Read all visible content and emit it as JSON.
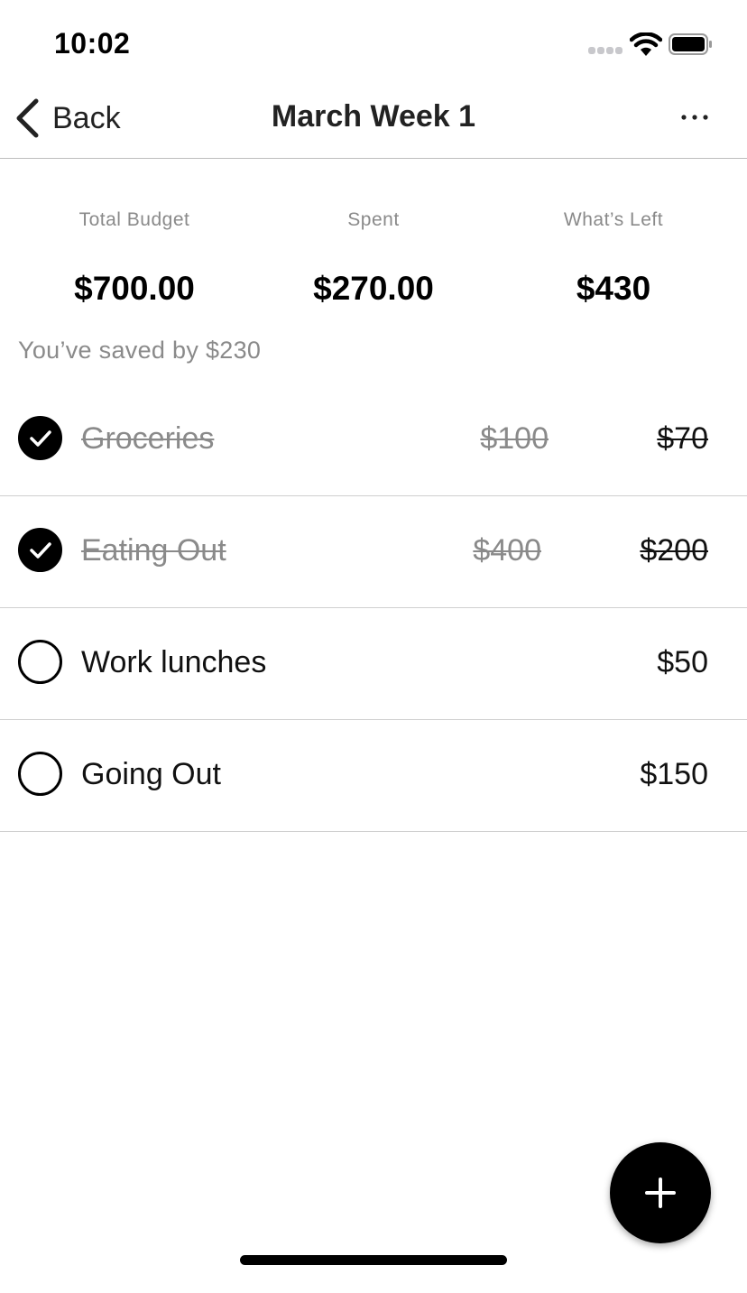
{
  "status_bar": {
    "time": "10:02"
  },
  "nav": {
    "back_label": "Back",
    "title": "March Week 1",
    "more_icon": "ellipsis-icon"
  },
  "summary": {
    "total_budget_label": "Total Budget",
    "total_budget_value": "$700.00",
    "spent_label": "Spent",
    "spent_value": "$270.00",
    "left_label": "What’s Left",
    "left_value": "$430",
    "saved_text": "You’ve saved by $230"
  },
  "items": [
    {
      "name": "Groceries",
      "budget": "$100",
      "amount": "$70",
      "checked": true
    },
    {
      "name": "Eating Out",
      "budget": "$400",
      "amount": "$200",
      "checked": true
    },
    {
      "name": "Work lunches",
      "budget": "",
      "amount": "$50",
      "checked": false
    },
    {
      "name": "Going Out",
      "budget": "",
      "amount": "$150",
      "checked": false
    }
  ],
  "fab_icon": "plus-icon"
}
